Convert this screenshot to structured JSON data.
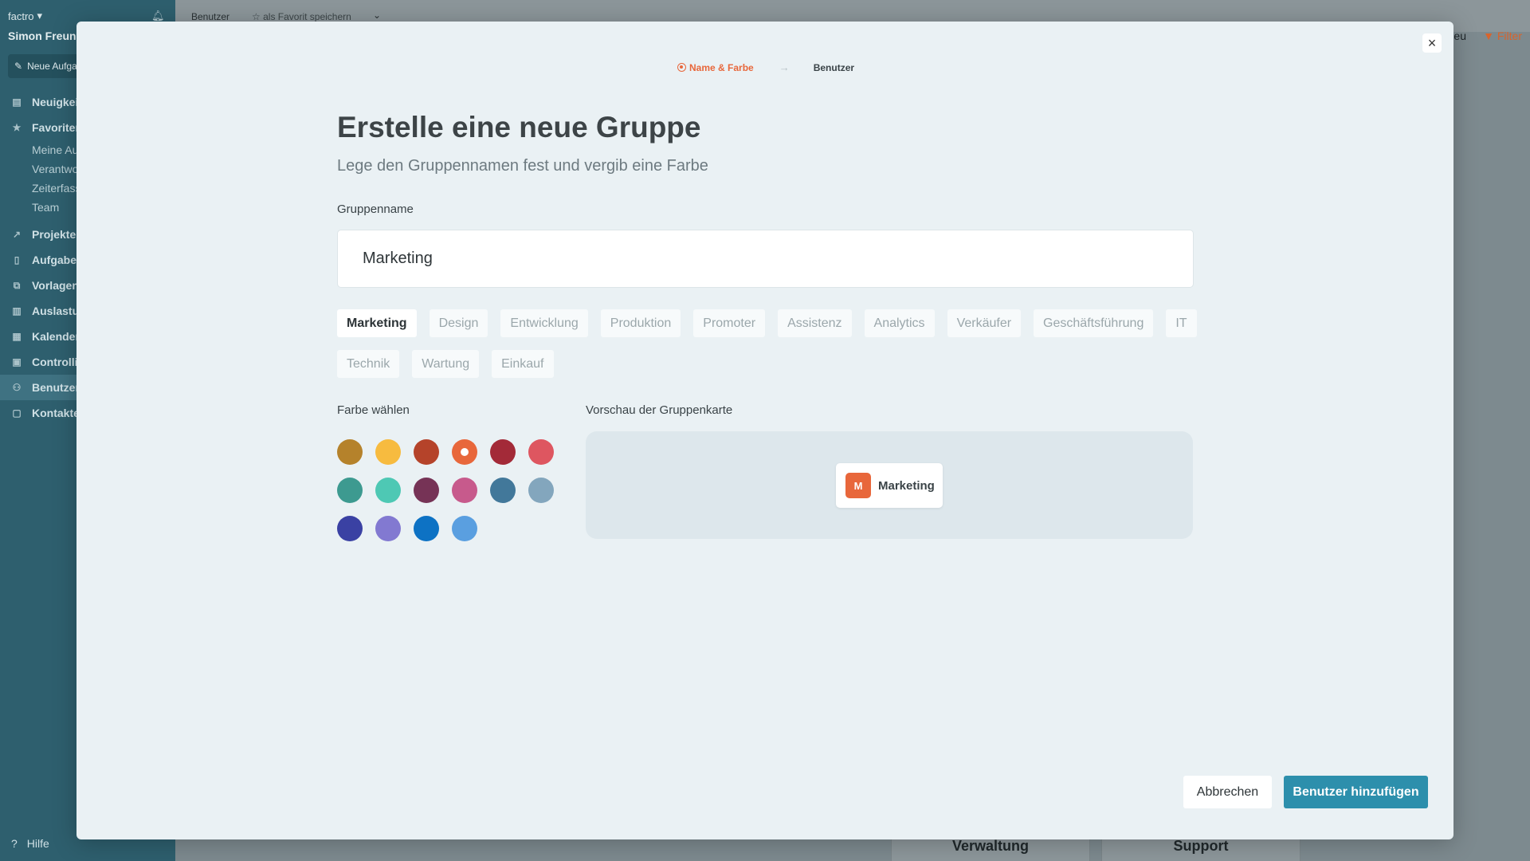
{
  "app": {
    "brand": "factro",
    "user": "Simon Freund",
    "new_task": "Neue Aufgabe",
    "nav": [
      {
        "label": "Neuigkeiten",
        "icon": "news-icon"
      },
      {
        "label": "Favoriten",
        "icon": "star-icon"
      }
    ],
    "fav_items": [
      "Meine Aufgaben",
      "Verantwortlich",
      "Zeiterfassung",
      "Team"
    ],
    "nav2": [
      {
        "label": "Projekte",
        "icon": "chart-icon"
      },
      {
        "label": "Aufgaben",
        "icon": "document-icon"
      },
      {
        "label": "Vorlagen",
        "icon": "copy-icon"
      },
      {
        "label": "Auslastung",
        "icon": "bar-chart-icon"
      },
      {
        "label": "Kalender",
        "icon": "calendar-icon"
      },
      {
        "label": "Controlling",
        "icon": "calculator-icon"
      },
      {
        "label": "Benutzer",
        "icon": "users-icon"
      },
      {
        "label": "Kontakte",
        "icon": "contact-icon"
      }
    ],
    "help": "Hilfe",
    "breadcrumb": "Benutzer",
    "save_favorite": "als Favorit speichern",
    "new_label": "Neu",
    "filter": "Filter",
    "bg_cards": [
      "Verwaltung",
      "Support"
    ]
  },
  "modal": {
    "steps": {
      "active": "Name & Farbe",
      "next": "Benutzer"
    },
    "title": "Erstelle eine neue Gruppe",
    "subtitle": "Lege den Gruppennamen fest und vergib eine Farbe",
    "name_label": "Gruppenname",
    "name_value": "Marketing",
    "suggestions": [
      "Marketing",
      "Design",
      "Entwicklung",
      "Produktion",
      "Promoter",
      "Assistenz",
      "Analytics",
      "Verkäufer",
      "Geschäftsführung",
      "IT",
      "Technik",
      "Wartung",
      "Einkauf"
    ],
    "selected_suggestion": "Marketing",
    "color_label": "Farbe wählen",
    "colors": [
      "#b5822b",
      "#f7bb3f",
      "#b5432a",
      "#e8673b",
      "#a32a38",
      "#de5660",
      "#3d9a90",
      "#4ec8b4",
      "#763356",
      "#c75a8c",
      "#42789a",
      "#83a6bd",
      "#3a41a3",
      "#8279d1",
      "#0d72c4",
      "#5a9fe0"
    ],
    "selected_color": "#e8673b",
    "preview_label": "Vorschau der Gruppenkarte",
    "preview": {
      "initial": "M",
      "name": "Marketing"
    },
    "cancel": "Abbrechen",
    "primary": "Benutzer hinzufügen"
  }
}
